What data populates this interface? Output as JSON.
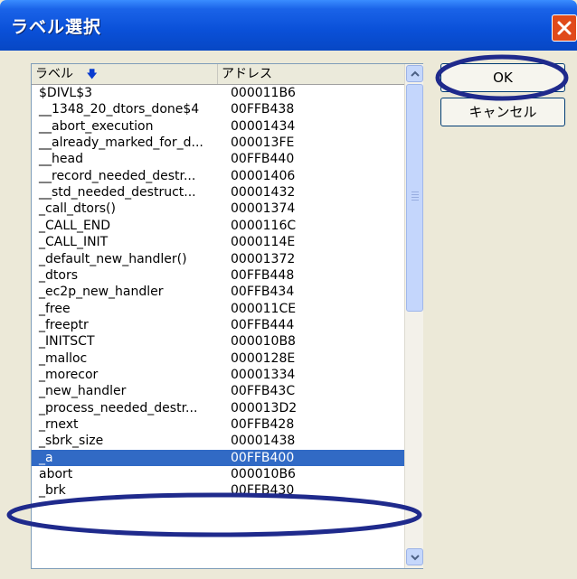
{
  "window": {
    "title": "ラベル選択"
  },
  "list": {
    "columns": [
      {
        "label": "ラベル",
        "sort_icon": "arrow-down-icon"
      },
      {
        "label": "アドレス"
      }
    ],
    "rows": [
      {
        "label": "$DIVL$3",
        "address": "000011B6"
      },
      {
        "label": "__1348_20_dtors_done$4",
        "address": "00FFB438"
      },
      {
        "label": "__abort_execution",
        "address": "00001434"
      },
      {
        "label": "__already_marked_for_d...",
        "address": "000013FE"
      },
      {
        "label": "__head",
        "address": "00FFB440"
      },
      {
        "label": "__record_needed_destr...",
        "address": "00001406"
      },
      {
        "label": "__std_needed_destruct...",
        "address": "00001432"
      },
      {
        "label": "_call_dtors()",
        "address": "00001374"
      },
      {
        "label": "_CALL_END",
        "address": "0000116C"
      },
      {
        "label": "_CALL_INIT",
        "address": "0000114E"
      },
      {
        "label": "_default_new_handler()",
        "address": "00001372"
      },
      {
        "label": "_dtors",
        "address": "00FFB448"
      },
      {
        "label": "_ec2p_new_handler",
        "address": "00FFB434"
      },
      {
        "label": "_free",
        "address": "000011CE"
      },
      {
        "label": "_freeptr",
        "address": "00FFB444"
      },
      {
        "label": "_INITSCT",
        "address": "000010B8"
      },
      {
        "label": "_malloc",
        "address": "0000128E"
      },
      {
        "label": "_morecor",
        "address": "00001334"
      },
      {
        "label": "_new_handler",
        "address": "00FFB43C"
      },
      {
        "label": "_process_needed_destr...",
        "address": "000013D2"
      },
      {
        "label": "_rnext",
        "address": "00FFB428"
      },
      {
        "label": "_sbrk_size",
        "address": "00001438"
      },
      {
        "label": "_a",
        "address": "00FFB400",
        "selected": true
      },
      {
        "label": "abort",
        "address": "000010B6"
      },
      {
        "label": "_brk",
        "address": "00FFB430"
      }
    ]
  },
  "buttons": {
    "ok": "OK",
    "cancel": "キャンセル"
  },
  "colors": {
    "selection": "#316ac5",
    "annotation": "#1f2a8c",
    "titlebar": "#0a50d8"
  }
}
